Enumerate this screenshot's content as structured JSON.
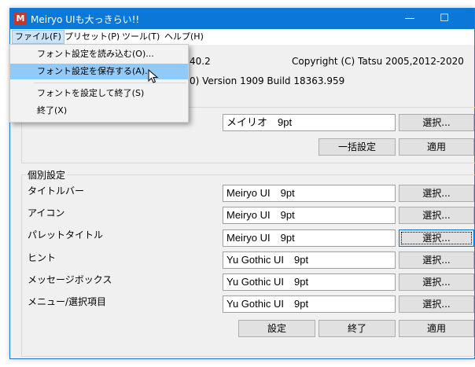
{
  "window": {
    "title": "Meiryo UIも大っきらい!!",
    "icon_label": "M"
  },
  "titlebar": {
    "minimize": "—",
    "maximize": "☐",
    "close": "✕"
  },
  "menubar": [
    "ファイル(F)",
    "プリセット(P)",
    "ツール(T)",
    "ヘルプ(H)"
  ],
  "info": {
    "version_tail": "40.2",
    "copyright": "Copyright (C) Tatsu 2005,2012-2020",
    "os_info": "0) Version 1909 Build 18363.959"
  },
  "common": {
    "font_value": "メイリオ　9pt",
    "select_label": "選択...",
    "bulk_label": "一括設定",
    "apply_label": "適用"
  },
  "individual": {
    "group_title": "個別設定",
    "rows": [
      {
        "label": "タイトルバー",
        "value": "Meiryo UI　9pt"
      },
      {
        "label": "アイコン",
        "value": "Meiryo UI　9pt"
      },
      {
        "label": "パレットタイトル",
        "value": "Meiryo UI　9pt"
      },
      {
        "label": "ヒント",
        "value": "Yu Gothic UI　9pt"
      },
      {
        "label": "メッセージボックス",
        "value": "Yu Gothic UI　9pt"
      },
      {
        "label": "メニュー/選択項目",
        "value": "Yu Gothic UI　9pt"
      }
    ],
    "select_label": "選択..."
  },
  "bottom": {
    "set_label": "設定",
    "exit_label": "終了",
    "apply_label": "適用"
  },
  "file_menu": [
    "フォント設定を読み込む(O)...",
    "フォント設定を保存する(A)...",
    "フォントを設定して終了(S)",
    "終了(X)"
  ]
}
